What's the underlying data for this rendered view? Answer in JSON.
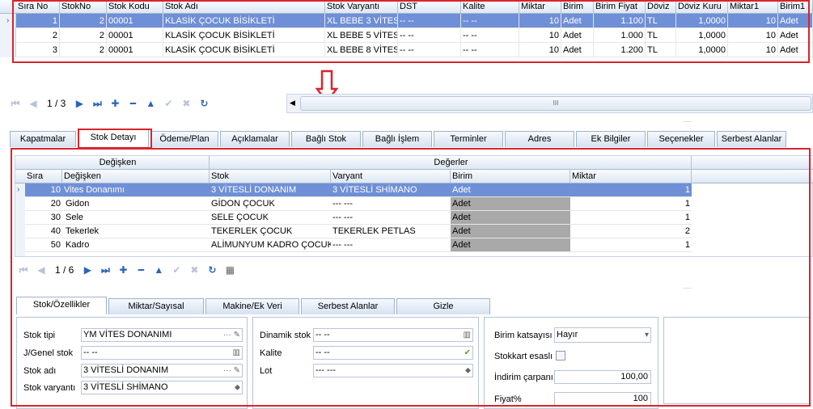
{
  "top_grid": {
    "columns": [
      "Sıra No",
      "StokNo",
      "Stok Kodu",
      "Stok Adı",
      "Stok Varyantı",
      "DST",
      "Kalite",
      "Miktar",
      "Birim",
      "Birim Fiyat",
      "Döviz",
      "Döviz Kuru",
      "Miktar1",
      "Birim1"
    ],
    "rows": [
      [
        "1",
        "2",
        "00001",
        "KLASİK ÇOCUK BİSİKLETİ",
        "XL BEBE 3 VİTES",
        "-- --",
        "-- --",
        "10",
        "Adet",
        "1.100",
        "TL",
        "1,0000",
        "10",
        "Adet"
      ],
      [
        "2",
        "2",
        "00001",
        "KLASİK ÇOCUK BİSİKLETİ",
        "XL BEBE 5 VİTES",
        "-- --",
        "-- --",
        "10",
        "Adet",
        "1.000",
        "TL",
        "1,0000",
        "10",
        "Adet"
      ],
      [
        "3",
        "2",
        "00001",
        "KLASİK ÇOCUK BİSİKLETİ",
        "XL BEBE 8 VİTES",
        "-- --",
        "-- --",
        "10",
        "Adet",
        "1.200",
        "TL",
        "1,0000",
        "10",
        "Adet"
      ]
    ]
  },
  "top_nav": {
    "page": "1 / 3"
  },
  "scroll_grip": "III",
  "arrow_icon": "down-arrow-annotation-icon",
  "main_tabs": [
    "Kapatmalar",
    "Stok Detayı",
    "Ödeme/Plan",
    "Açıklamalar",
    "Bağlı Stok",
    "Bağlı İşlem",
    "Terminler",
    "Adres",
    "Ek Bilgiler",
    "Seçenekler",
    "Serbest Alanlar"
  ],
  "detail_grid": {
    "band_left": "Değişken",
    "band_right": "Değerler",
    "columns": [
      "Sıra",
      "Değişken",
      "Stok",
      "Varyant",
      "Birim",
      "Miktar"
    ],
    "rows": [
      [
        "10",
        "Vites Donanımı",
        "3 VİTESLİ DONANIM",
        "3 VİTESLİ SHİMANO",
        "Adet",
        "1"
      ],
      [
        "20",
        "Gidon",
        "GİDON ÇOCUK",
        "--- ---",
        "Adet",
        "1"
      ],
      [
        "30",
        "Sele",
        "SELE ÇOCUK",
        "--- ---",
        "Adet",
        "1"
      ],
      [
        "40",
        "Tekerlek",
        "TEKERLEK ÇOCUK",
        "TEKERLEK PETLAS",
        "Adet",
        "2"
      ],
      [
        "50",
        "Kadro",
        "ALİMUNYUM KADRO ÇOCUK",
        "--- ---",
        "Adet",
        "1"
      ]
    ]
  },
  "detail_nav": {
    "page": "1 / 6"
  },
  "sub_tabs": [
    "Stok/Özellikler",
    "Miktar/Sayısal",
    "Makine/Ek Veri",
    "Serbest Alanlar",
    "Gizle"
  ],
  "form": {
    "stok_tipi_label": "Stok tipi",
    "stok_tipi_value": "YM VİTES DONANIMI",
    "j_genel_label": "J/Genel stok",
    "j_genel_value": "-- --",
    "stok_adi_label": "Stok adı",
    "stok_adi_value": "3 VİTESLİ DONANIM",
    "stok_varyanti_label": "Stok varyantı",
    "stok_varyanti_value": "3 VİTESLİ SHİMANO",
    "dinamik_label": "Dinamik stok",
    "dinamik_value": "-- --",
    "kalite_label": "Kalite",
    "kalite_value": "-- --",
    "lot_label": "Lot",
    "lot_value": "--- ---",
    "birim_kats_label": "Birim katsayısı",
    "birim_kats_value": "Hayır",
    "stokkart_label": "Stokkart esaslı",
    "indirim_label": "İndirim çarpanı",
    "indirim_value": "100,00",
    "fiyat_label": "Fiyat%",
    "fiyat_value": "100"
  },
  "colors": {
    "selection": "#6f8fd6",
    "annotation": "#d9242c",
    "nav": "#2a64b8"
  }
}
